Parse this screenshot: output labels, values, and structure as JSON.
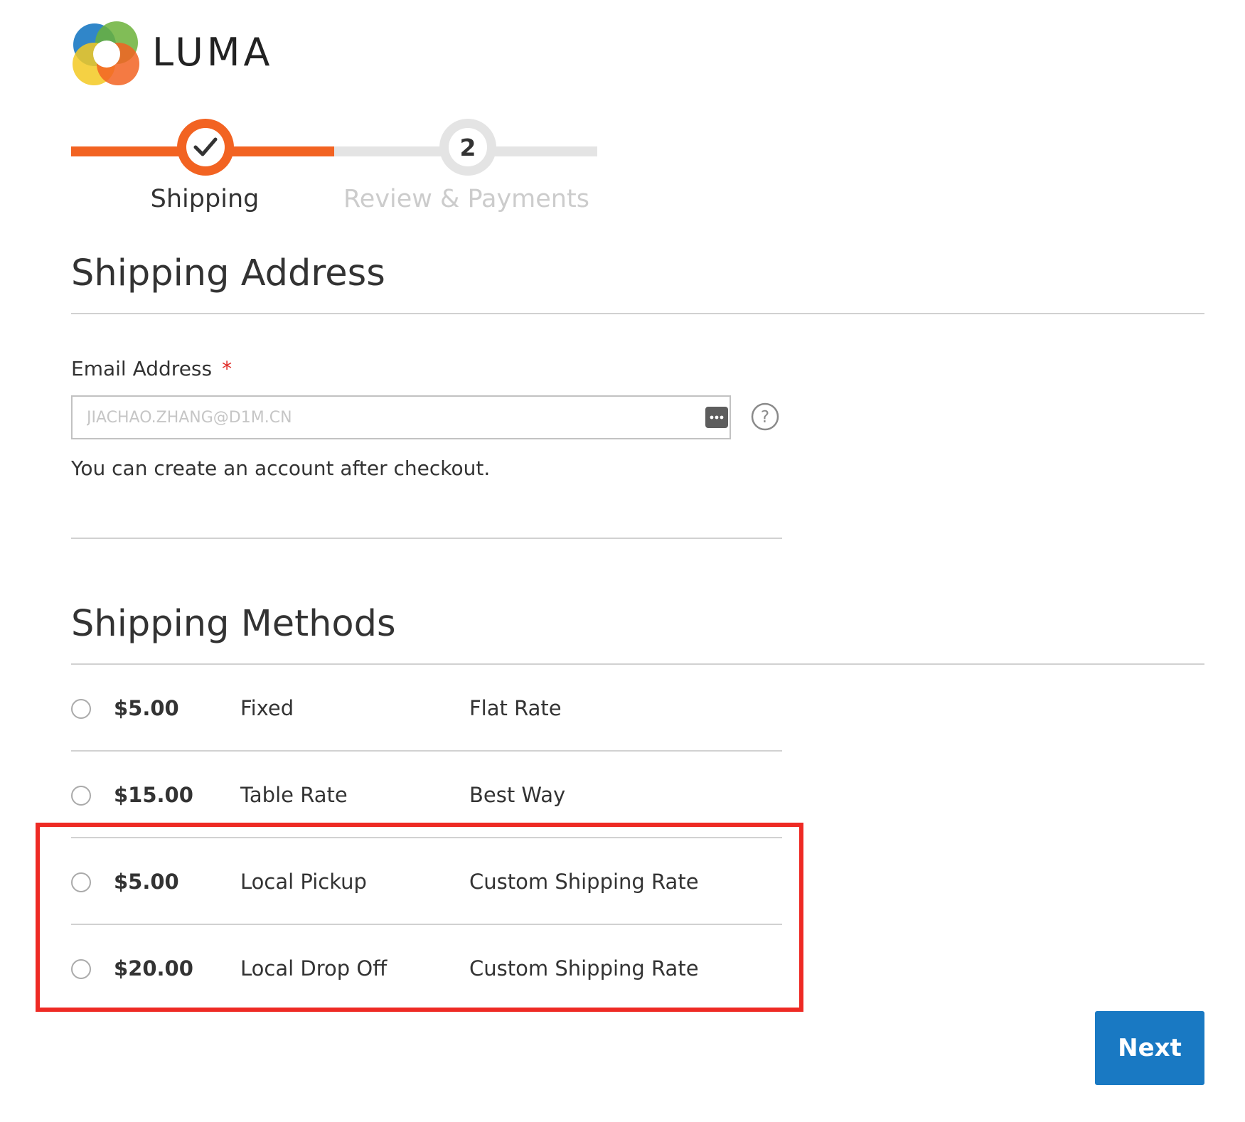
{
  "brand": {
    "name": "LUMA",
    "logo_colors": [
      "#1979c3",
      "#6bb23a",
      "#f3c922",
      "#f26322"
    ]
  },
  "progress": {
    "steps": [
      {
        "label": "Shipping",
        "status": "complete",
        "icon": "checkmark-icon"
      },
      {
        "label": "Review & Payments",
        "number": "2",
        "status": "pending"
      }
    ],
    "active_color": "#f26322",
    "inactive_color": "#e4e4e4"
  },
  "shipping_address": {
    "title": "Shipping Address",
    "email": {
      "label": "Email Address",
      "required_mark": "*",
      "value": "JIACHAO.ZHANG@D1M.CN",
      "password_manager_icon": "ellipsis-key-icon",
      "help_icon": "question-circle-icon"
    },
    "note": "You can create an account after checkout."
  },
  "shipping_methods": {
    "title": "Shipping Methods",
    "rows": [
      {
        "price": "$5.00",
        "method": "Fixed",
        "carrier": "Flat Rate",
        "selected": false
      },
      {
        "price": "$15.00",
        "method": "Table Rate",
        "carrier": "Best Way",
        "selected": false
      },
      {
        "price": "$5.00",
        "method": "Local Pickup",
        "carrier": "Custom Shipping Rate",
        "selected": false
      },
      {
        "price": "$20.00",
        "method": "Local Drop Off",
        "carrier": "Custom Shipping Rate",
        "selected": false
      }
    ],
    "highlight_color": "#ee2a24"
  },
  "actions": {
    "next_label": "Next",
    "next_color": "#1979c3"
  }
}
